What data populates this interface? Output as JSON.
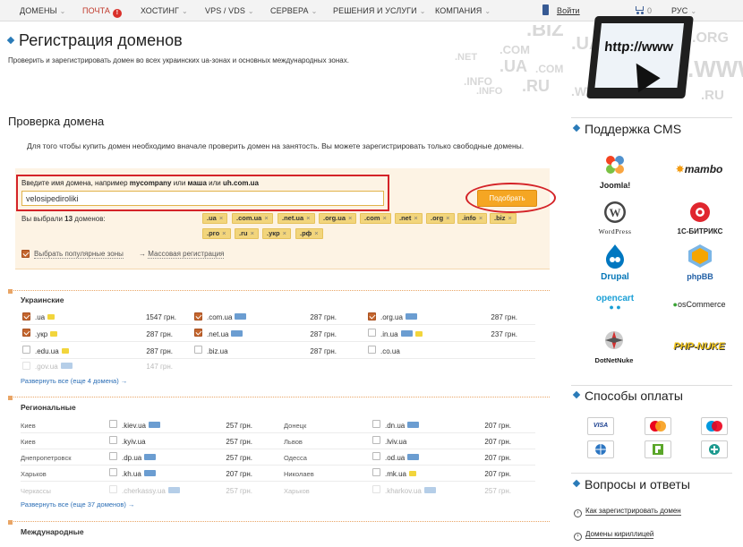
{
  "nav": {
    "items": [
      {
        "label": "ДОМЕНЫ",
        "chev": "⌄"
      },
      {
        "label": "ПОЧТА",
        "chev": "",
        "badge": "!"
      },
      {
        "label": "ХОСТИНГ",
        "chev": "⌄"
      },
      {
        "label": "VPS / VDS",
        "chev": "⌄"
      },
      {
        "label": "СЕРВЕРА",
        "chev": "⌄"
      },
      {
        "label": "РЕШЕНИЯ И УСЛУГИ",
        "chev": "⌄"
      },
      {
        "label": "КОМПАНИЯ",
        "chev": "⌄"
      }
    ],
    "login": "Войти",
    "cart_count": "0",
    "lang": "РУС"
  },
  "header": {
    "title": "Регистрация доменов",
    "subtitle": "Проверить и зарегистрировать домен во всех украинских ua-зонах и основных международных зонах.",
    "banner_words": [
      ".BIZ",
      ".UA",
      ".ORG",
      ".WWW",
      ".COM",
      ".NET",
      ".UA",
      ".COM",
      ".INFO",
      ".RU",
      ".INFO",
      ".RU",
      ".WWW"
    ],
    "monitor_text": "http://www"
  },
  "check": {
    "title": "Проверка домена",
    "description": "Для того чтобы купить домен необходимо вначале проверить домен на занятость. Вы можете зарегистрировать только свободные домены.",
    "hint_pre": "Введите имя домена, например ",
    "hint_ex1": "mycompany",
    "hint_mid1": " или ",
    "hint_ex2": "маша",
    "hint_mid2": " или ",
    "hint_ex3": "uh.com.ua",
    "input_value": "velosipediroliki",
    "button_label": "Подобрать",
    "chosen_pre": "Вы выбрали ",
    "chosen_count": "13",
    "chosen_post": " доменов:",
    "tags": [
      ".ua",
      ".com.ua",
      ".net.ua",
      ".org.ua",
      ".com",
      ".net",
      ".org",
      ".info",
      ".biz",
      ".pro",
      ".ru",
      ".укр",
      ".рф"
    ],
    "popular_label": "Выбрать популярные зоны",
    "mass_arrow": "→",
    "mass_label": "Массовая регистрация"
  },
  "ukrainian": {
    "title": "Украинские",
    "rows": [
      [
        {
          "zone": ".ua",
          "checked": true,
          "icon": "chat",
          "price": "1547 грн."
        },
        {
          "zone": ".com.ua",
          "checked": true,
          "icon": "idn",
          "price": "287 грн."
        },
        {
          "zone": ".org.ua",
          "checked": true,
          "icon": "idn",
          "price": "287 грн."
        }
      ],
      [
        {
          "zone": ".укр",
          "checked": true,
          "icon": "chat",
          "price": "287 грн."
        },
        {
          "zone": ".net.ua",
          "checked": true,
          "icon": "idn",
          "price": "287 грн."
        },
        {
          "zone": ".in.ua",
          "checked": false,
          "icon": "idn+chat",
          "price": "237 грн."
        }
      ],
      [
        {
          "zone": ".edu.ua",
          "checked": false,
          "icon": "chat",
          "price": "287 грн."
        },
        {
          "zone": ".biz.ua",
          "checked": false,
          "icon": "",
          "price": "287 грн."
        },
        {
          "zone": ".co.ua",
          "checked": false,
          "icon": "",
          "price": ""
        }
      ],
      [
        {
          "zone": ".gov.ua",
          "checked": false,
          "icon": "idn",
          "price": "147 грн.",
          "faded": true
        }
      ]
    ],
    "expand": "Развернуть все (еще 4 домена) →"
  },
  "regional": {
    "title": "Региональные",
    "rows": [
      [
        {
          "city": "Киев",
          "zone": ".kiev.ua",
          "price": "257 грн."
        },
        {
          "city": "Донецк",
          "zone": ".dn.ua",
          "price": "207 грн."
        }
      ],
      [
        {
          "city": "Киев",
          "zone": ".kyiv.ua",
          "price": "257 грн."
        },
        {
          "city": "Львов",
          "zone": ".lviv.ua",
          "price": "207 грн."
        }
      ],
      [
        {
          "city": "Днепропетровск",
          "zone": ".dp.ua",
          "price": "257 грн."
        },
        {
          "city": "Одесса",
          "zone": ".od.ua",
          "price": "207 грн."
        }
      ],
      [
        {
          "city": "Харьков",
          "zone": ".kh.ua",
          "price": "207 грн."
        },
        {
          "city": "Николаев",
          "zone": ".mk.ua",
          "price": "207 грн."
        }
      ],
      [
        {
          "city": "Черкассы",
          "zone": ".cherkassy.ua",
          "price": "257 грн.",
          "faded": true
        },
        {
          "city": "Харьков",
          "zone": ".kharkov.ua",
          "price": "257 грн.",
          "faded": true
        }
      ]
    ],
    "expand": "Развернуть все (еще 37 доменов) →"
  },
  "international": {
    "title": "Международные"
  },
  "sidebar": {
    "cms_title": "Поддержка CMS",
    "cms": [
      "Joomla!",
      "mambo",
      "WordPress",
      "1С-БИТРИКС",
      "Drupal",
      "phpBB",
      "opencart",
      "osCommerce",
      "DotNetNuke",
      "PHP-NUKE"
    ],
    "payment_title": "Способы оплаты",
    "payments": [
      "VISA",
      "MasterCard",
      "Maestro",
      "WebMoney",
      "Privat24",
      "Plus"
    ],
    "faq_title": "Вопросы и ответы",
    "faq": [
      "Как зарегистрировать домен",
      "Домены кириллицей"
    ]
  }
}
